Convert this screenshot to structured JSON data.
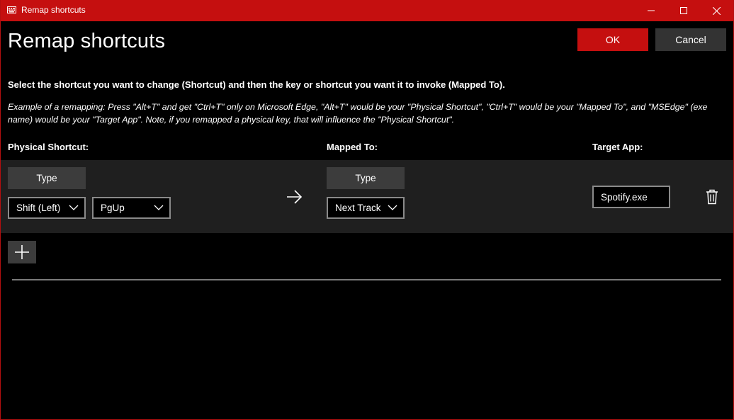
{
  "window": {
    "title": "Remap shortcuts",
    "accent_color": "#c50f0f",
    "icon": "keyboard-icon",
    "controls": [
      "minimize-icon",
      "maximize-icon",
      "close-icon"
    ]
  },
  "header": {
    "title": "Remap shortcuts",
    "ok_label": "OK",
    "cancel_label": "Cancel"
  },
  "instructions": {
    "main": "Select the shortcut you want to change (Shortcut) and then the key or shortcut you want it to invoke (Mapped To).",
    "example": "Example of a remapping: Press \"Alt+T\" and get \"Ctrl+T\" only on Microsoft Edge, \"Alt+T\" would be your \"Physical Shortcut\", \"Ctrl+T\" would be your \"Mapped To\", and \"MSEdge\" (exe name) would be your \"Target App\". Note, if you remapped a physical key, that will influence the \"Physical Shortcut\"."
  },
  "columns": {
    "physical": "Physical Shortcut:",
    "mapped": "Mapped To:",
    "target": "Target App:"
  },
  "mapping": {
    "physical_type_label": "Type",
    "physical_keys": [
      "Shift (Left)",
      "PgUp"
    ],
    "arrow_icon": "arrow-right-icon",
    "mapped_type_label": "Type",
    "mapped_keys": [
      "Next Track"
    ],
    "target_app": "Spotify.exe",
    "delete_icon": "trash-icon"
  },
  "add_icon": "plus-icon"
}
